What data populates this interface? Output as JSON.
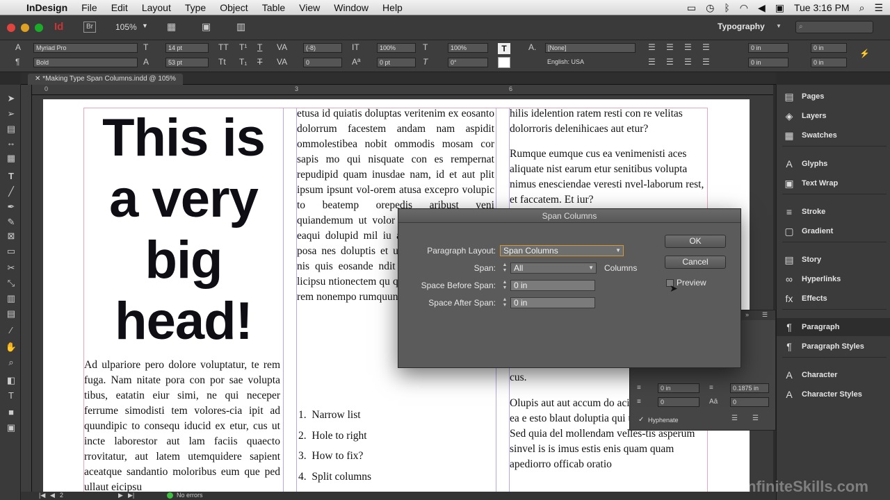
{
  "menubar": {
    "app_name": "InDesign",
    "items": [
      "File",
      "Edit",
      "Layout",
      "Type",
      "Object",
      "Table",
      "View",
      "Window",
      "Help"
    ],
    "clock": "Tue 3:16 PM"
  },
  "appbar": {
    "zoom": "105%",
    "workspace": "Typography",
    "br_label": "Br",
    "id_label": "Id"
  },
  "control_panel": {
    "font_family": "Myriad Pro",
    "font_style": "Bold",
    "font_size": "14 pt",
    "leading": "53 pt",
    "kerning": "(-8)",
    "tracking": "0",
    "vertical_scale": "100%",
    "horizontal_scale": "100%",
    "baseline_shift": "0 pt",
    "skew": "0°",
    "char_style": "[None]",
    "language": "English: USA",
    "indent_left": "0 in",
    "indent_first": "0 in",
    "indent_right": "0 in",
    "indent_last": "0 in"
  },
  "document": {
    "tab_title": "*Making Type Span Columns.indd @ 105%",
    "ruler_labels": [
      "0",
      "3",
      "6"
    ],
    "headline": "This is a very big head!",
    "col1_body": "Ad ulpariore pero dolore voluptatur, te rem fuga. Nam nitate pora con por sae volupta tibus, eatatin eiur simi, ne qui neceper ferrume simodisti tem volores-cia ipit ad quundipic to consequ iducid ex etur, cus ut incte laborestor aut lam faciis quaecto rrovitatur, aut latem utemquidere sapient aceatque sandantio moloribus eum que ped ullaut eicipsu",
    "col2_top": "etusa id quiatis doluptas veritenim ex eosanto dolorrum facestem andam nam aspidit ommolestibea nobit ommodis mosam cor sapis mo qui nisquate con es rempernat repudipid quam inusdae nam, id et aut plit ipsum ipsunt vol-orem atusa excepro volupic to beatemp orepedis aribust veni quiandemum ut volor maximusa illitam qu eaqui dolupid mil iu audae il inverum exp posa nes doluptis et u sa poremol upturibu nis quis eosande ndit quunt omniendicae i licipsu ntionectem qu quaecatam velit reprem rem nonempo rumquundi doluptae exerio.",
    "list_items": [
      "Narrow list",
      "Hole to right",
      "How to fix?",
      "Split columns"
    ],
    "list_numbers": [
      "1.",
      "2.",
      "3.",
      "4."
    ],
    "col3_top": "hilis idelention ratem resti con re velitas dolorroris delenihicaes aut etur?",
    "col3_para2": "Rumque eumque cus ea venimenisti aces aliquate nist earum etur senitibus volupta nimus enesciendae veresti nvel-laborum rest, et faccatem. Et iur?",
    "col3_cus": "cus.",
    "col3_bottom": "Olupis aut aut accum do aciisi consecum quo ea e esto blaut doluptia qui ullor sundi autem. Sed quia del mollendam velles-tis asperum sinvel is is imus estis enis quam quam apediorro officab oratio"
  },
  "status_bar": {
    "page": "2",
    "errors": "No errors"
  },
  "panels": {
    "items": [
      {
        "label": "Pages",
        "icon": "pages-icon",
        "glyph": "▤"
      },
      {
        "label": "Layers",
        "icon": "layers-icon",
        "glyph": "◈"
      },
      {
        "label": "Swatches",
        "icon": "swatches-icon",
        "glyph": "▦"
      },
      {
        "label": "Glyphs",
        "icon": "glyphs-icon",
        "glyph": "A"
      },
      {
        "label": "Text Wrap",
        "icon": "text-wrap-icon",
        "glyph": "▣"
      },
      {
        "label": "Stroke",
        "icon": "stroke-icon",
        "glyph": "≡"
      },
      {
        "label": "Gradient",
        "icon": "gradient-icon",
        "glyph": "▢"
      },
      {
        "label": "Story",
        "icon": "story-icon",
        "glyph": "▤"
      },
      {
        "label": "Hyperlinks",
        "icon": "hyperlinks-icon",
        "glyph": "∞"
      },
      {
        "label": "Effects",
        "icon": "effects-icon",
        "glyph": "fx"
      },
      {
        "label": "Paragraph",
        "icon": "paragraph-icon",
        "glyph": "¶"
      },
      {
        "label": "Paragraph Styles",
        "icon": "paragraph-styles-icon",
        "glyph": "¶"
      },
      {
        "label": "Character",
        "icon": "character-icon",
        "glyph": "A"
      },
      {
        "label": "Character Styles",
        "icon": "character-styles-icon",
        "glyph": "A"
      }
    ]
  },
  "para_panel": {
    "space_before": "0 in",
    "space_after": "0.1875 in",
    "drop_cap_lines": "0",
    "drop_cap_chars": "0",
    "hyphenate_label": "Hyphenate"
  },
  "dialog": {
    "title": "Span Columns",
    "paragraph_layout_label": "Paragraph Layout:",
    "paragraph_layout_value": "Span Columns",
    "span_label": "Span:",
    "span_value": "All",
    "columns_label": "Columns",
    "space_before_label": "Space Before Span:",
    "space_before_value": "0 in",
    "space_after_label": "Space After Span:",
    "space_after_value": "0 in",
    "ok_label": "OK",
    "cancel_label": "Cancel",
    "preview_label": "Preview"
  },
  "watermark": "InfiniteSkills.com"
}
